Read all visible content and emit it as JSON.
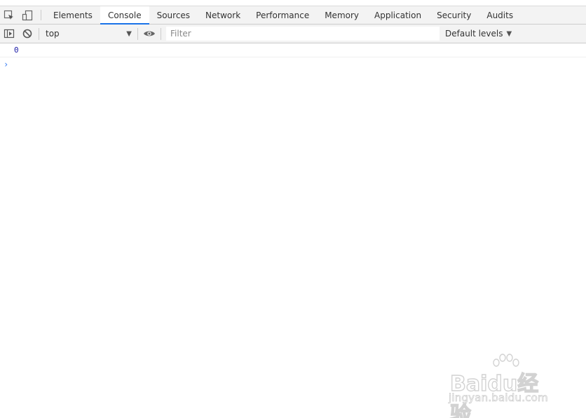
{
  "tabs": [
    "Elements",
    "Console",
    "Sources",
    "Network",
    "Performance",
    "Memory",
    "Application",
    "Security",
    "Audits"
  ],
  "active_tab": "Console",
  "toolbar": {
    "context": "top",
    "filter_placeholder": "Filter",
    "levels": "Default levels"
  },
  "console": {
    "output_value": "0",
    "prompt_symbol": "›"
  },
  "watermark": {
    "brand": "Baidu经验",
    "url": "jingyan.baidu.com"
  },
  "colors": {
    "accent": "#1a73e8",
    "number": "#1a1aa6",
    "prompt": "#367cf1"
  },
  "icons": [
    "inspect-element-icon",
    "device-toolbar-icon",
    "sidebar-toggle-icon",
    "clear-console-icon",
    "eye-icon"
  ]
}
